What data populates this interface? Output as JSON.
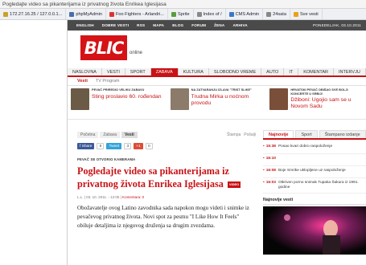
{
  "browser": {
    "tab_title": "Pogledajte video sa pikanterijama iz privatnog života Enrikea Iglesijasa",
    "bookmarks": [
      {
        "label": "172.27.16.25 / 127.0.0.1...",
        "icon": "server-icon",
        "color": "#c9a227"
      },
      {
        "label": "phpMyAdmin",
        "icon": "phpmyadmin-icon",
        "color": "#4a6ea9"
      },
      {
        "label": "Foo Fighters - Arlandri...",
        "icon": "music-icon",
        "color": "#d33"
      },
      {
        "label": "Sprite",
        "icon": "sprite-icon",
        "color": "#5a9e3a"
      },
      {
        "label": "Index of /",
        "icon": "folder-icon",
        "color": "#888"
      },
      {
        "label": "CMS Admin",
        "icon": "cms-icon",
        "color": "#3a78c9"
      },
      {
        "label": "24sata",
        "icon": "news-icon",
        "color": "#888"
      },
      {
        "label": "Sve vesti",
        "icon": "star-icon",
        "color": "#e8a317"
      }
    ]
  },
  "site": {
    "topnav": [
      "ENGLISH",
      "DOBRE VESTI",
      "RSS",
      "MAPA",
      "BLOG",
      "FORUM",
      "ŽENA",
      "ARHIVA"
    ],
    "date": "PONEDELJAK, 03.10.2011",
    "logo_text": "BLIC",
    "logo_sub": "online",
    "mainnav": [
      "NASLOVNA",
      "VESTI",
      "SPORT",
      "ZABAVA",
      "KULTURA",
      "SLOBODNO VREME",
      "AUTO",
      "IT",
      "KOMENTAR",
      "INTERVJU"
    ],
    "mainnav_active": "ZABAVA",
    "subnav": [
      "Vesti",
      "TV Program"
    ],
    "subnav_active": "Vesti"
  },
  "teasers": [
    {
      "kicker": "PEVAČ PRIREDIO VELIKU ZABAVU",
      "title": "Sting proslavio 60. rođendan",
      "thumb_color": "#6b5a45"
    },
    {
      "kicker": "NA ZATVARANJU IZLAVA \"TRIST SLIKE\"",
      "title": "Trudna Mirka u noćnom provodu",
      "thumb_color": "#8c7b6a"
    },
    {
      "kicker": "HRVATSKI PEVAČ OBIŠAO SVE BOLJI KONCERTE U SRBIJI",
      "title": "Džiboni: Ugojio sam se u Novom Sadu",
      "thumb_color": "#7a4f3a"
    }
  ],
  "article": {
    "crumbs": [
      "Početna",
      "Zabava",
      "Vesti"
    ],
    "crumbs_active": "Vesti",
    "tools": [
      "Štampa",
      "Pošalji"
    ],
    "share": {
      "fb_label": "Share",
      "fb_count": "6",
      "tweet_label": "Tweet",
      "tweet_count": "3",
      "gplus_count": "0"
    },
    "kicker": "PEVAČ SE OTVORIO KAMERAMA",
    "headline": "Pogledajte video sa pikanterijama iz privatnog života Enrikea Iglesijasa",
    "video_badge": "VIDEO",
    "meta_author": "L.L. | 03. 10. 2011. - 12:05 |",
    "meta_comments": "Komentara: 0",
    "lead": "Obožavatelje ovog Latino zavodnika sada napokon mogu videti i snimke iz pevačevog privatnog života. Novi spot za pesmu \"I Like How It Feels\" obiluje detaljima iz njegovog druženja sa drugim zvezdama."
  },
  "sidebar": {
    "tabs": [
      "Najnovije",
      "Sport",
      "Štampano izdanje"
    ],
    "active_tab": "Najnovije",
    "news": [
      {
        "time": "15:38",
        "text": "Posao kvari dobro raspoloženje"
      },
      {
        "time": "16:10",
        "text": ""
      },
      {
        "time": "16:08",
        "text": "Boje Smrike uklopljene uz raspoloženje"
      },
      {
        "time": "16:03",
        "text": "Otkriven porno snimak Tupaka Šakura iz 1991. godine"
      }
    ],
    "video_title": "Najnovije vesti"
  }
}
